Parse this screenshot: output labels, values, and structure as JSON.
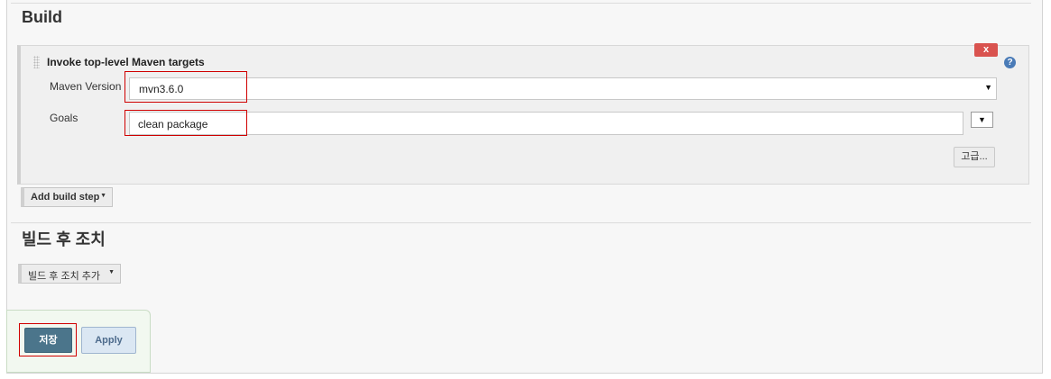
{
  "build_section": {
    "title": "Build",
    "step": {
      "title": "Invoke top-level Maven targets",
      "delete_label": "x",
      "help_label": "?",
      "maven_version": {
        "label": "Maven Version",
        "value": "mvn3.6.0",
        "arrow": "▼"
      },
      "goals": {
        "label": "Goals",
        "value": "clean package",
        "expand_label": "▼"
      },
      "advanced_label": "고급..."
    },
    "add_step_label": "Add build step",
    "add_step_caret": "▼"
  },
  "post_build_section": {
    "title": "빌드 후 조치",
    "add_action_label": "빌드 후 조치 추가",
    "add_action_caret": "▼"
  },
  "footer": {
    "save_label": "저장",
    "apply_label": "Apply"
  }
}
